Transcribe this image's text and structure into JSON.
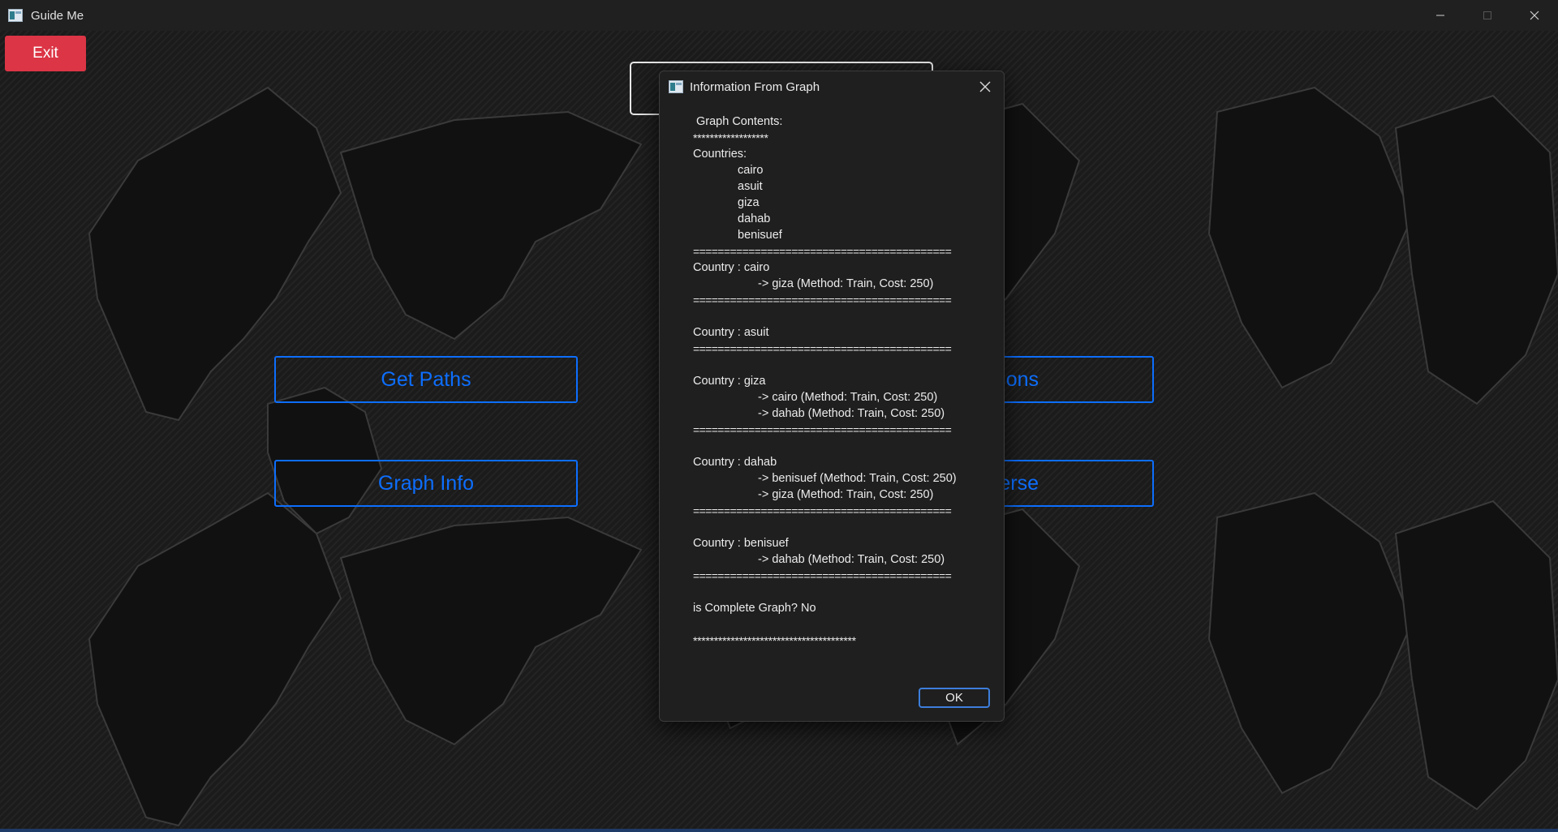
{
  "window": {
    "title": "Guide Me",
    "minimize_icon": "minimize-icon",
    "maximize_icon": "maximize-icon",
    "close_icon": "close-icon"
  },
  "main": {
    "exit_label": "Exit",
    "buttons": [
      {
        "label": "Get Paths"
      },
      {
        "label": "ons"
      },
      {
        "label": "Graph Info"
      },
      {
        "label": "erse"
      }
    ]
  },
  "dialog": {
    "title": "Information From Graph",
    "close_icon": "close-icon",
    "ok_label": "OK",
    "lines": [
      {
        "text": "Graph Contents:",
        "style": "pad-left"
      },
      {
        "text": "******************",
        "style": "stars"
      },
      {
        "text": "Countries:",
        "style": ""
      },
      {
        "text": "cairo",
        "style": "indent1"
      },
      {
        "text": "asuit",
        "style": "indent1"
      },
      {
        "text": "giza",
        "style": "indent1"
      },
      {
        "text": "dahab",
        "style": "indent1"
      },
      {
        "text": "benisuef",
        "style": "indent1"
      },
      {
        "text": "==========================================",
        "style": "sep"
      },
      {
        "text": "Country : cairo",
        "style": ""
      },
      {
        "text": "-> giza (Method: Train, Cost: 250)",
        "style": "indent2"
      },
      {
        "text": "==========================================",
        "style": "sep"
      },
      {
        "text": "",
        "style": ""
      },
      {
        "text": "Country : asuit",
        "style": ""
      },
      {
        "text": "==========================================",
        "style": "sep"
      },
      {
        "text": "",
        "style": ""
      },
      {
        "text": "Country : giza",
        "style": ""
      },
      {
        "text": "-> cairo (Method: Train, Cost: 250)",
        "style": "indent2"
      },
      {
        "text": "-> dahab (Method: Train, Cost: 250)",
        "style": "indent2"
      },
      {
        "text": "==========================================",
        "style": "sep"
      },
      {
        "text": "",
        "style": ""
      },
      {
        "text": "Country : dahab",
        "style": ""
      },
      {
        "text": "-> benisuef (Method: Train, Cost: 250)",
        "style": "indent2"
      },
      {
        "text": "-> giza (Method: Train, Cost: 250)",
        "style": "indent2"
      },
      {
        "text": "==========================================",
        "style": "sep"
      },
      {
        "text": "",
        "style": ""
      },
      {
        "text": "Country : benisuef",
        "style": ""
      },
      {
        "text": "-> dahab (Method: Train, Cost: 250)",
        "style": "indent2"
      },
      {
        "text": "==========================================",
        "style": "sep"
      },
      {
        "text": "",
        "style": ""
      },
      {
        "text": "is Complete Graph? No",
        "style": ""
      },
      {
        "text": "",
        "style": ""
      },
      {
        "text": "***************************************",
        "style": "stars"
      }
    ]
  },
  "colors": {
    "accent": "#0d6efd",
    "exit": "#dc3545",
    "dialog_bg": "#1f1f1f",
    "ok_border": "#3d7edb"
  }
}
